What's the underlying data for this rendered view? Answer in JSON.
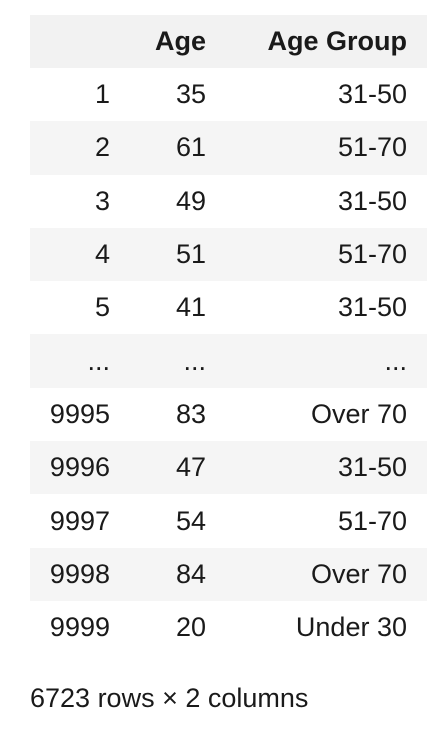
{
  "table": {
    "columns": {
      "index": "",
      "age": "Age",
      "age_group": "Age Group"
    },
    "rows": [
      {
        "index": "1",
        "age": "35",
        "age_group": "31-50"
      },
      {
        "index": "2",
        "age": "61",
        "age_group": "51-70"
      },
      {
        "index": "3",
        "age": "49",
        "age_group": "31-50"
      },
      {
        "index": "4",
        "age": "51",
        "age_group": "51-70"
      },
      {
        "index": "5",
        "age": "41",
        "age_group": "31-50"
      },
      {
        "index": "...",
        "age": "...",
        "age_group": "..."
      },
      {
        "index": "9995",
        "age": "83",
        "age_group": "Over 70"
      },
      {
        "index": "9996",
        "age": "47",
        "age_group": "31-50"
      },
      {
        "index": "9997",
        "age": "54",
        "age_group": "51-70"
      },
      {
        "index": "9998",
        "age": "84",
        "age_group": "Over 70"
      },
      {
        "index": "9999",
        "age": "20",
        "age_group": "Under 30"
      }
    ]
  },
  "shape_caption": "6723 rows × 2 columns"
}
